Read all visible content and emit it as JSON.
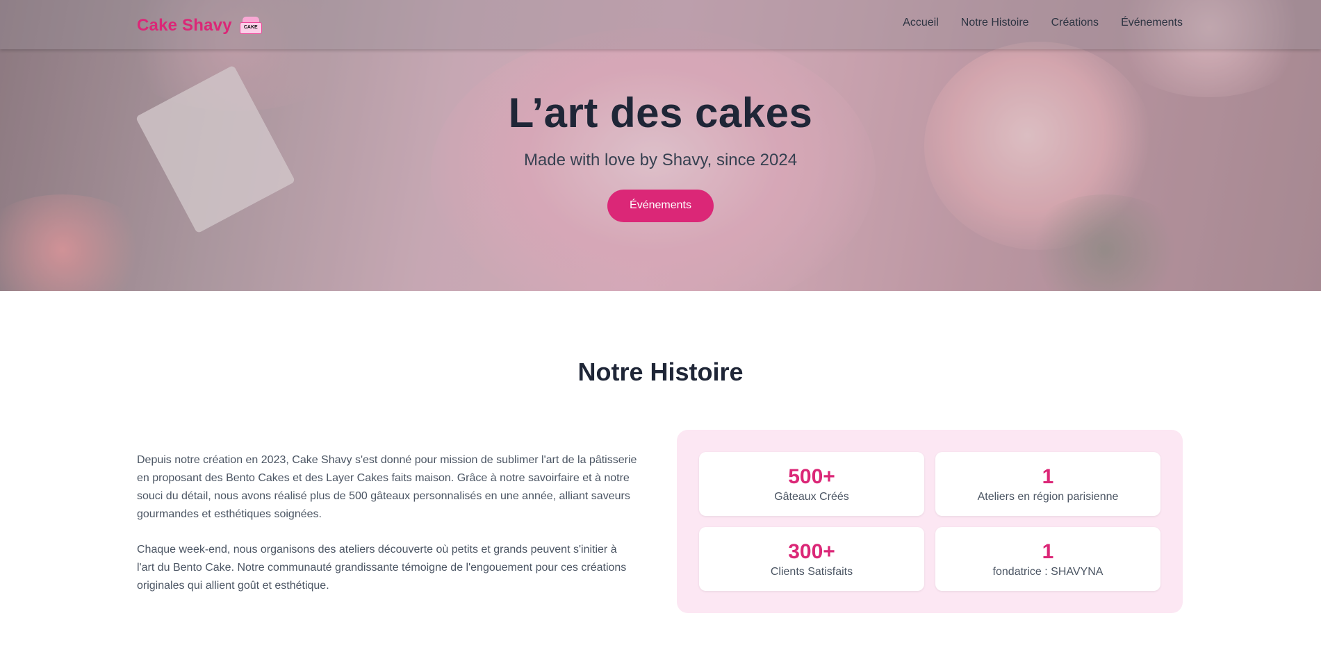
{
  "nav": {
    "brand": "Cake Shavy",
    "logo_text": "CAKE",
    "links": [
      "Accueil",
      "Notre Histoire",
      "Créations",
      "Événements"
    ]
  },
  "hero": {
    "title": "L’art des cakes",
    "subtitle": "Made with love by Shavy, since 2024",
    "cta_label": "Événements"
  },
  "histoire": {
    "title": "Notre Histoire",
    "paragraphs": [
      "Depuis notre création en 2023, Cake Shavy s'est donné pour mission de sublimer l'art de la pâtisserie en proposant des Bento Cakes et des Layer Cakes faits maison. Grâce à notre savoirfaire et à notre souci du détail, nous avons réalisé plus de 500 gâteaux personnalisés en une année, alliant saveurs gourmandes et esthétiques soignées.",
      "Chaque week-end, nous organisons des ateliers découverte où petits et grands peuvent s'initier à l'art du Bento Cake. Notre communauté grandissante témoigne de l'engouement pour ces créations originales qui allient goût et esthétique."
    ],
    "stats": [
      {
        "value": "500+",
        "label": "Gâteaux Créés"
      },
      {
        "value": "1",
        "label": "Ateliers en région parisienne"
      },
      {
        "value": "300+",
        "label": "Clients Satisfaits"
      },
      {
        "value": "1",
        "label": "fondatrice : SHAVYNA"
      }
    ]
  },
  "colors": {
    "accent": "#db2777",
    "stats_bg": "#fce7f3",
    "heading": "#1f2637"
  }
}
